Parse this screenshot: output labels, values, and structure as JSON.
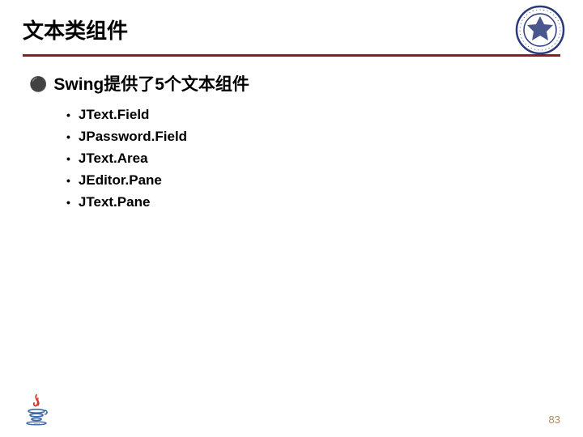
{
  "title": "文本类组件",
  "main_bullet": "Swing提供了5个文本组件",
  "sub_items": [
    "JText.Field",
    "JPassword.Field",
    "JText.Area",
    "JEditor.Pane",
    "JText.Pane"
  ],
  "page_number": "83"
}
